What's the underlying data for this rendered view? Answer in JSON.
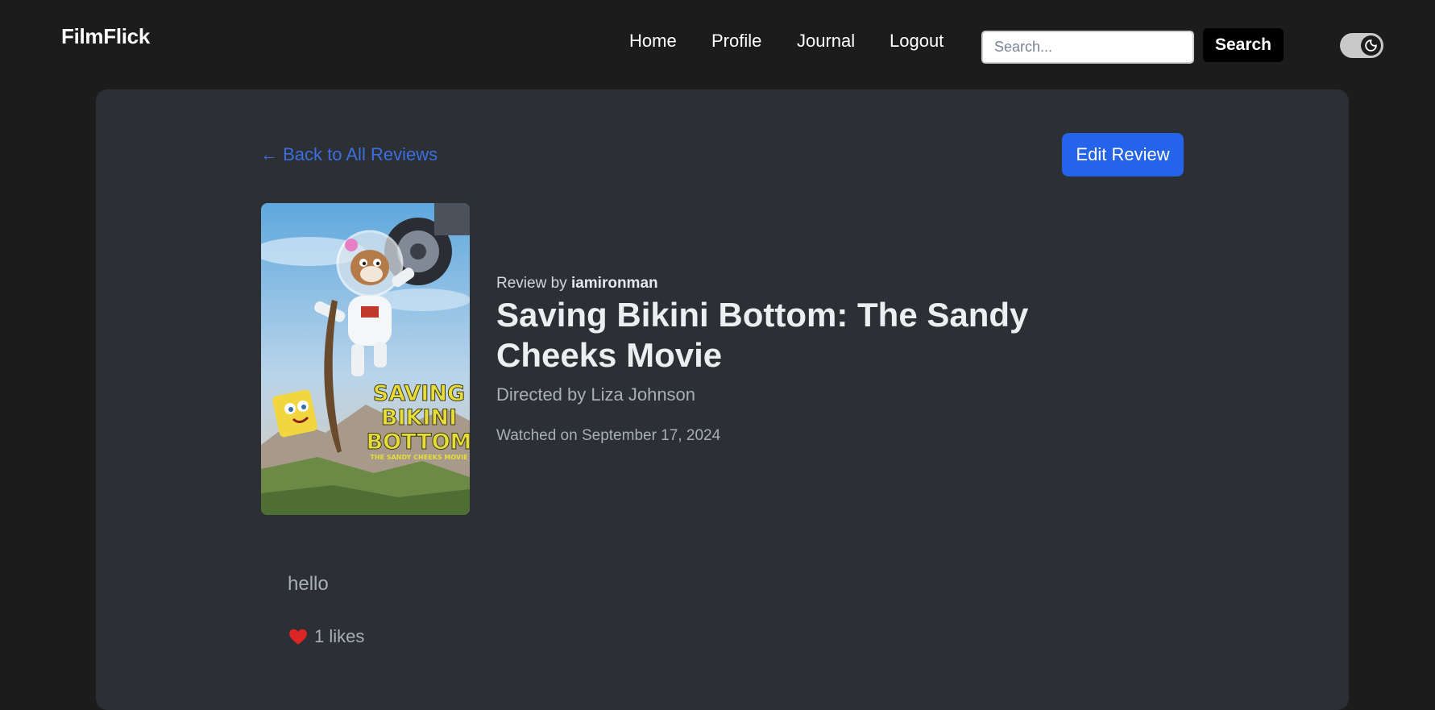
{
  "nav": {
    "brand": "FilmFlick",
    "links": [
      "Home",
      "Profile",
      "Journal",
      "Logout"
    ],
    "search_placeholder": "Search...",
    "search_button": "Search",
    "theme_toggle_icon": "moon-icon"
  },
  "review": {
    "back_link": "← Back to All Reviews",
    "edit_button": "Edit Review",
    "by_prefix": "Review by",
    "author": "iamironman",
    "movie_title": "Saving Bikini Bottom: The Sandy Cheeks Movie",
    "director": "Directed by Liza Johnson",
    "watched": "Watched on September 17, 2024",
    "text": "hello",
    "likes": "1 likes"
  },
  "poster": {
    "title_line1": "SAVING",
    "title_line2": "BIKINI",
    "title_line3": "BOTTOM",
    "tagline": "THE SANDY CHEEKS MOVIE"
  },
  "colors": {
    "background": "#1c1c1c",
    "card": "#2c2f34",
    "accent": "#2563eb",
    "link": "#3b6fe0",
    "heart": "#dc2626"
  }
}
